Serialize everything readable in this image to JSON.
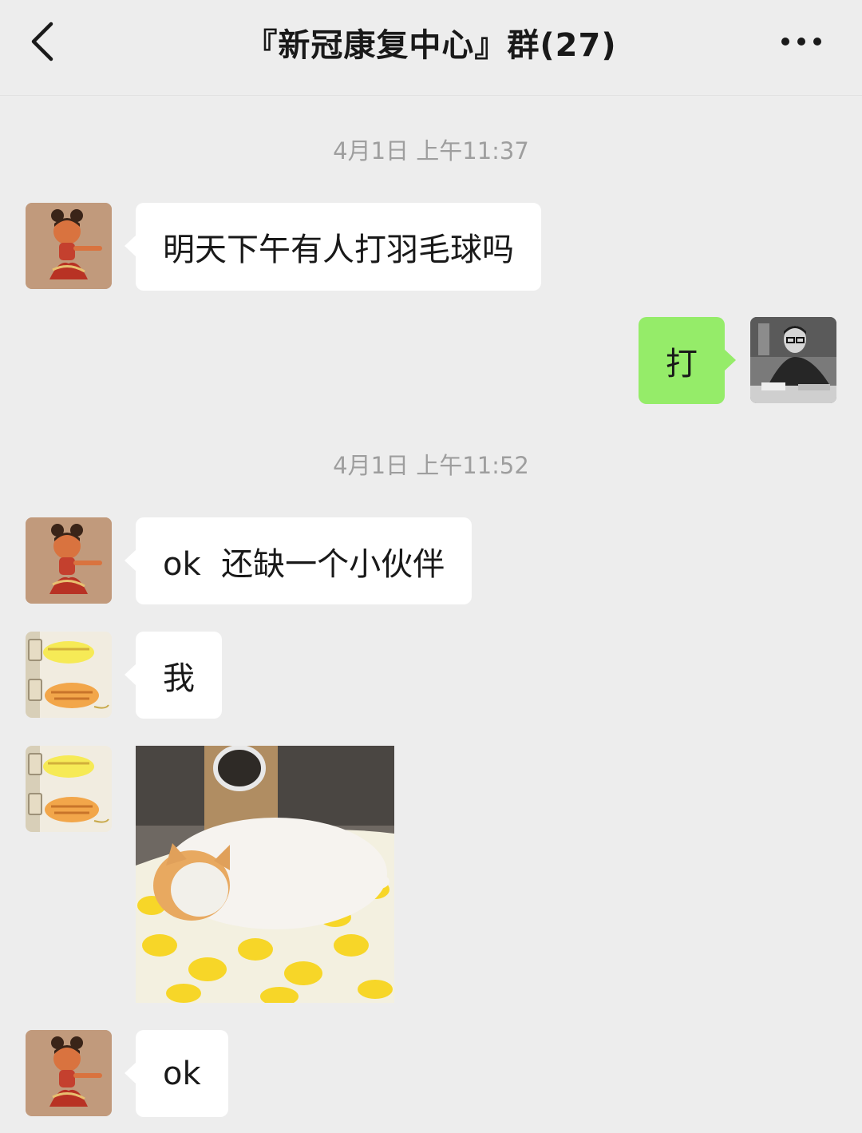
{
  "header": {
    "title": "『新冠康复中心』群(27)"
  },
  "messages": {
    "time1": "4月1日 上午11:37",
    "msg1": "明天下午有人打羽毛球吗",
    "msg2": "打",
    "time2": "4月1日 上午11:52",
    "msg3": "ok  还缺一个小伙伴",
    "msg4": "我",
    "msg6": "ok"
  },
  "colors": {
    "background": "#ededed",
    "bubble_incoming": "#ffffff",
    "bubble_outgoing": "#95ec69",
    "timestamp": "#9e9e9e"
  }
}
